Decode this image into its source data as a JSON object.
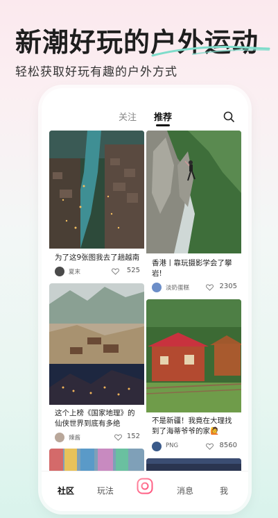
{
  "header": {
    "headline": "新潮好玩的户外运动",
    "subheadline": "轻松获取好玩有趣的户外方式"
  },
  "tabs": {
    "follow": "关注",
    "recommend": "推荐"
  },
  "feed": [
    {
      "title": "为了这9张图我去了趟越南",
      "author": "夏末",
      "likes": "525"
    },
    {
      "title": "香港丨靠玩摄影学会了攀岩!",
      "author": "淡奶蛋糕",
      "likes": "2305"
    },
    {
      "title": "这个上榜《国家地理》的仙侠世界到底有多绝",
      "author": "辣酱",
      "likes": "152"
    },
    {
      "title": "不是新疆！我竟在大理找到了海蒂爷爷的家🙋",
      "author": "PNG",
      "likes": "8560"
    }
  ],
  "bottom_nav": {
    "community": "社区",
    "play": "玩法",
    "messages": "消息",
    "me": "我"
  },
  "colors": {
    "accent": "#6fd6c4",
    "text": "#222222"
  },
  "icons": [
    "search-icon",
    "heart-icon",
    "camera-icon"
  ]
}
